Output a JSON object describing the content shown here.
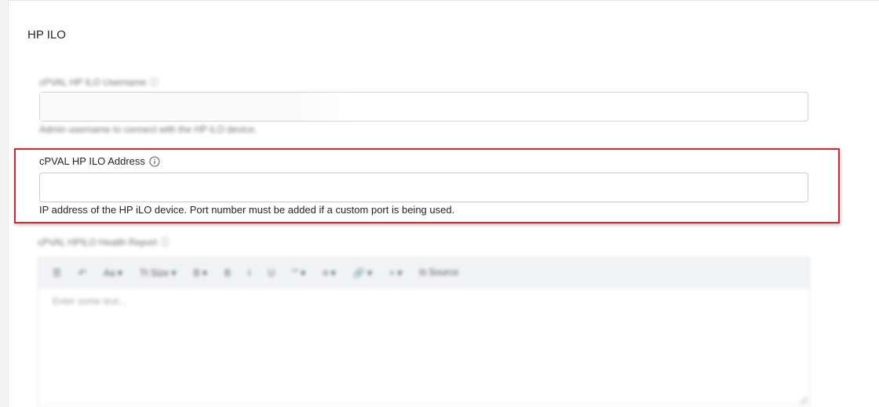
{
  "section": {
    "title": "HP ILO"
  },
  "username_field": {
    "label": "cPVAL HP ILO Username ⓘ",
    "value": "",
    "help": "Admin username to connect with the HP iLO device."
  },
  "address_field": {
    "label": "cPVAL HP ILO Address",
    "value": "",
    "help": "IP address of the HP iLO device. Port number must be added if a custom port is being used."
  },
  "report_field": {
    "label": "cPVAL HPILO Health Report",
    "toolbar": [
      "☰",
      "↶",
      "Aa ▾",
      "Tt Size ▾",
      "B ▾",
      "B",
      "I",
      "U",
      "“” ▾",
      "≡ ▾",
      "🔗 ▾",
      "+ ▾",
      "⧉ Source"
    ],
    "placeholder": "Enter some text..."
  },
  "colors": {
    "highlight_border": "#d9262e",
    "input_border": "#c9cdd2"
  }
}
